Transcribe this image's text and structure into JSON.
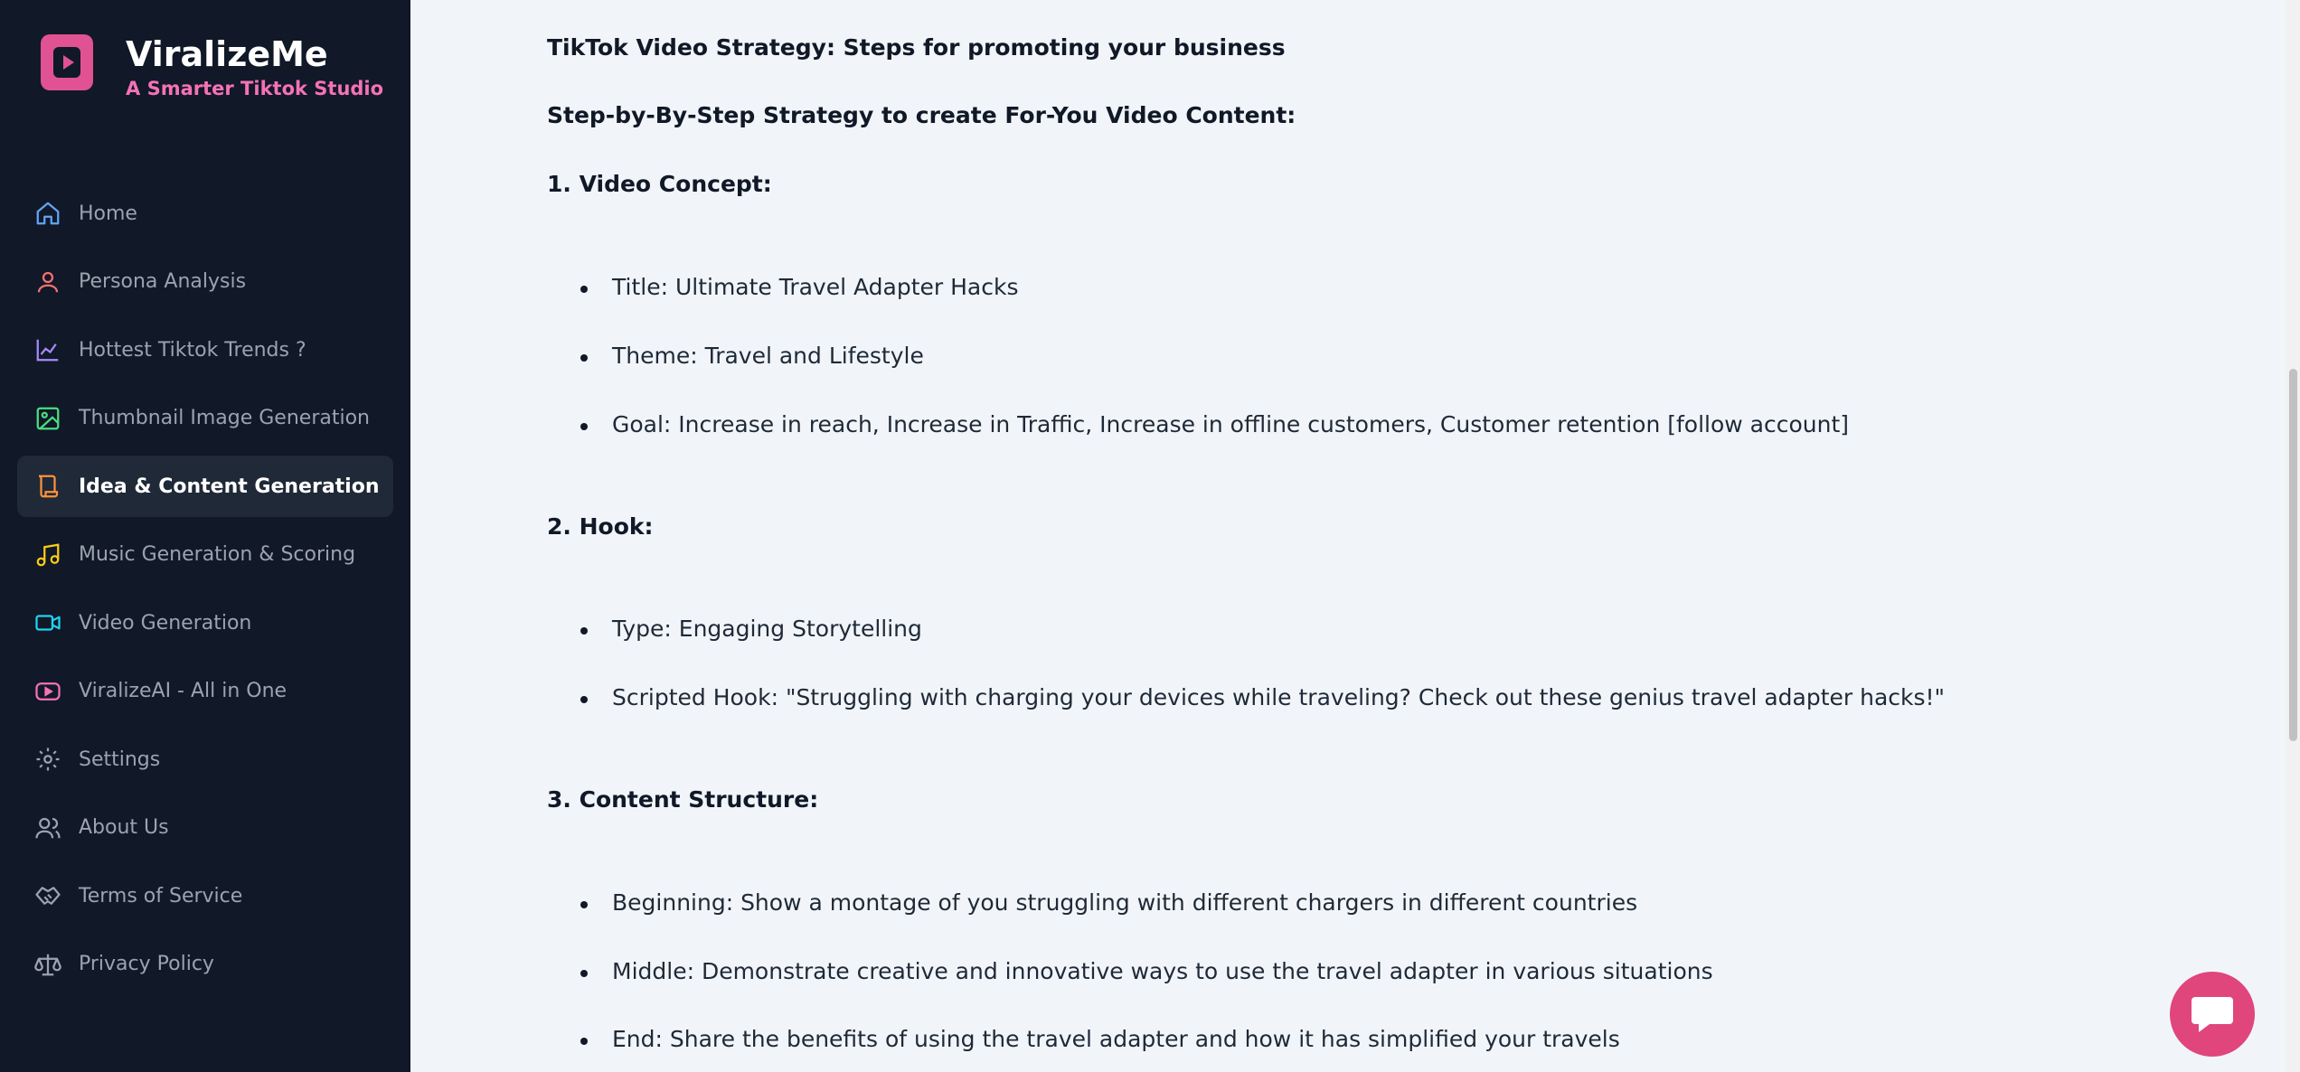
{
  "brand": {
    "title": "ViralizeMe",
    "subtitle": "A Smarter Tiktok Studio",
    "logo_icon": "play-logo-icon",
    "accent": "#e05292"
  },
  "sidebar": {
    "items": [
      {
        "label": "Home",
        "icon": "home-icon",
        "color": "#60a5fa",
        "active": false
      },
      {
        "label": "Persona Analysis",
        "icon": "user-icon",
        "color": "#f87171",
        "active": false
      },
      {
        "label": "Hottest Tiktok Trends ?",
        "icon": "chart-icon",
        "color": "#a78bfa",
        "active": false
      },
      {
        "label": "Thumbnail Image Generation",
        "icon": "image-icon",
        "color": "#4ade80",
        "active": false
      },
      {
        "label": "Idea & Content Generation",
        "icon": "scroll-icon",
        "color": "#fb923c",
        "active": true
      },
      {
        "label": "Music Generation & Scoring",
        "icon": "music-icon",
        "color": "#facc15",
        "active": false
      },
      {
        "label": "Video Generation",
        "icon": "video-icon",
        "color": "#22d3ee",
        "active": false
      },
      {
        "label": "ViralizeAI - All in One",
        "icon": "youtube-icon",
        "color": "#f472b6",
        "active": false
      },
      {
        "label": "Settings",
        "icon": "gear-icon",
        "color": "#9ca3af",
        "active": false
      },
      {
        "label": "About Us",
        "icon": "users-icon",
        "color": "#9ca3af",
        "active": false
      },
      {
        "label": "Terms of Service",
        "icon": "handshake-icon",
        "color": "#9ca3af",
        "active": false
      },
      {
        "label": "Privacy Policy",
        "icon": "scale-icon",
        "color": "#9ca3af",
        "active": false
      }
    ]
  },
  "content": {
    "title": "TikTok Video Strategy: Steps for promoting your business",
    "subtitle": "Step-by-By-Step Strategy to create For-You Video Content:",
    "sections": [
      {
        "heading": "1. Video Concept:",
        "items": [
          "Title: Ultimate Travel Adapter Hacks",
          "Theme: Travel and Lifestyle",
          "Goal: Increase in reach, Increase in Traffic, Increase in offline customers, Customer retention [follow account]"
        ]
      },
      {
        "heading": "2. Hook:",
        "items": [
          "Type: Engaging Storytelling",
          "Scripted Hook: \"Struggling with charging your devices while traveling? Check out these genius travel adapter hacks!\""
        ]
      },
      {
        "heading": "3. Content Structure:",
        "items": [
          "Beginning: Show a montage of you struggling with different chargers in different countries",
          "Middle: Demonstrate creative and innovative ways to use the travel adapter in various situations",
          "End: Share the benefits of using the travel adapter and how it has simplified your travels"
        ]
      }
    ]
  },
  "chat": {
    "icon": "chat-bubble-icon",
    "color": "#e0457b"
  }
}
